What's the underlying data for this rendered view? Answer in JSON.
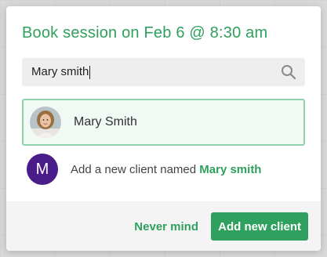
{
  "dialog": {
    "title": "Book session on Feb 6 @ 8:30 am"
  },
  "search": {
    "value": "Mary smith",
    "icon": "search-icon"
  },
  "results": {
    "existing_client": {
      "name": "Mary Smith",
      "avatar": "client-photo"
    },
    "new_client": {
      "avatar_letter": "M",
      "prefix": "Add a new client named ",
      "name": "Mary smith",
      "avatar_color": "#4a1c8a"
    }
  },
  "footer": {
    "cancel_label": "Never mind",
    "confirm_label": "Add new client"
  },
  "colors": {
    "accent": "#2fa05e",
    "selected_border": "#8fcfaa",
    "selected_bg": "#f1f9f4"
  }
}
